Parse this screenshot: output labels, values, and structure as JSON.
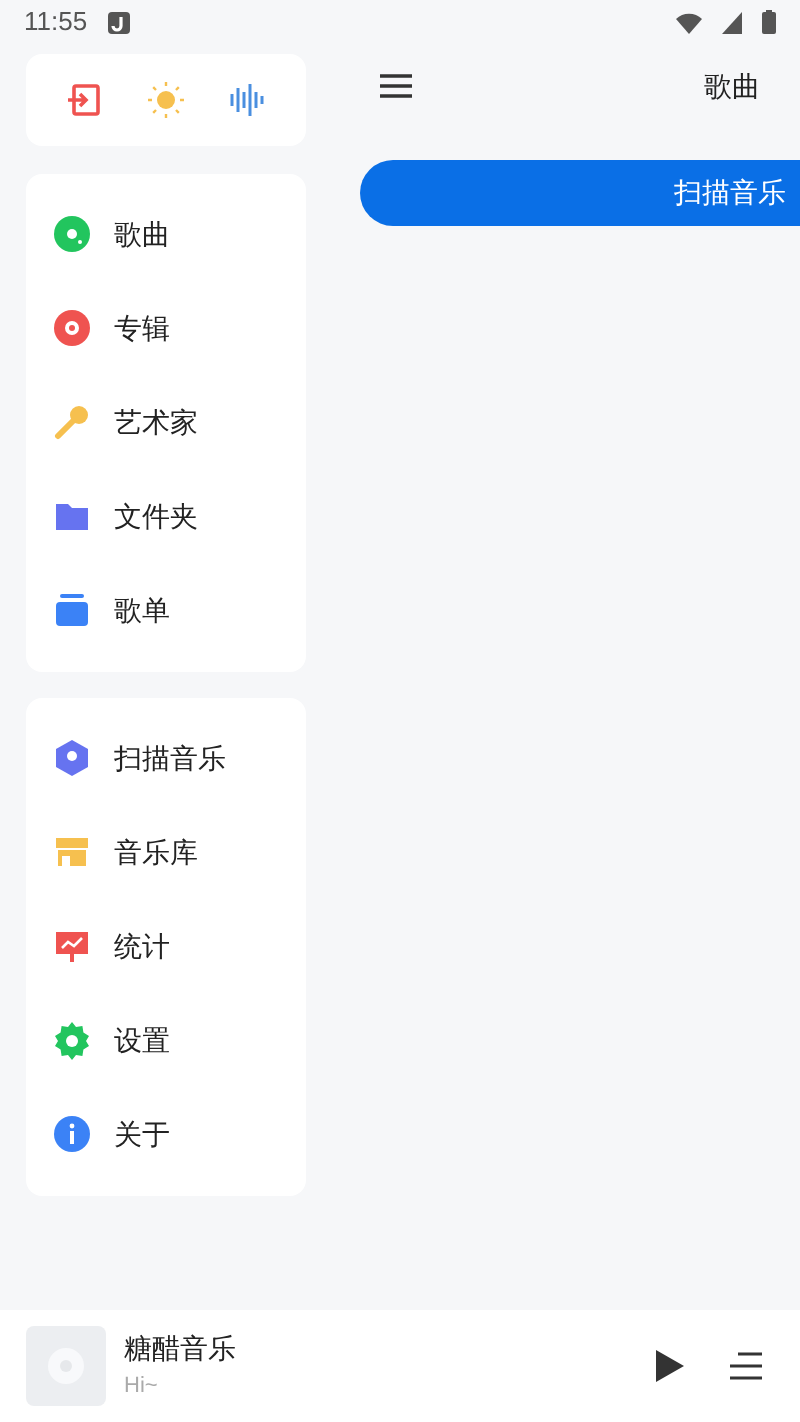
{
  "status_bar": {
    "time": "11:55"
  },
  "drawer": {
    "quick_actions": [
      {
        "kind": "exit"
      },
      {
        "kind": "theme"
      },
      {
        "kind": "equalizer"
      }
    ],
    "sections": [
      {
        "items": [
          {
            "label": "歌曲",
            "kind": "disc",
            "color": "#22c55e"
          },
          {
            "label": "专辑",
            "kind": "album",
            "color": "#ef5350"
          },
          {
            "label": "艺术家",
            "kind": "mic",
            "color": "#f6c04f"
          },
          {
            "label": "文件夹",
            "kind": "folder",
            "color": "#6673f0"
          },
          {
            "label": "歌单",
            "kind": "stack",
            "color": "#3b82f6"
          }
        ]
      },
      {
        "items": [
          {
            "label": "扫描音乐",
            "kind": "scan",
            "color": "#6673f0"
          },
          {
            "label": "音乐库",
            "kind": "store",
            "color": "#f6c04f"
          },
          {
            "label": "统计",
            "kind": "stats",
            "color": "#ef5350"
          },
          {
            "label": "设置",
            "kind": "gear",
            "color": "#22c55e"
          },
          {
            "label": "关于",
            "kind": "info",
            "color": "#3b82f6"
          }
        ]
      }
    ]
  },
  "toolbar": {
    "title": "歌曲"
  },
  "scan_button": {
    "label": "扫描音乐"
  },
  "player": {
    "title": "糖醋音乐",
    "subtitle": "Hi~"
  }
}
